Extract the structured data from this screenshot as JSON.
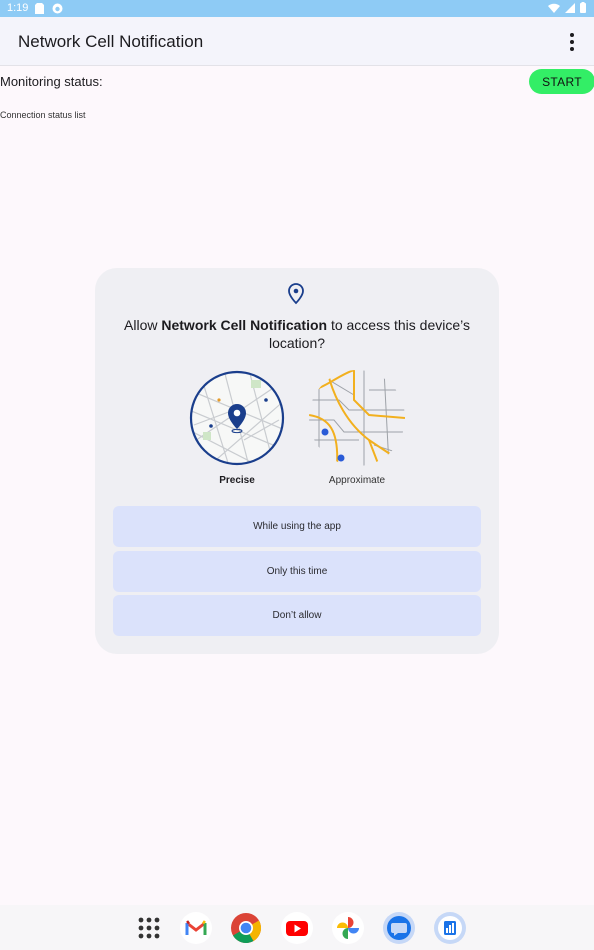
{
  "status_bar": {
    "time": "1:19"
  },
  "app_bar": {
    "title": "Network Cell Notification"
  },
  "main": {
    "monitoring_label": "Monitoring status:",
    "start_button": "START",
    "connection_list_label": "Connection status list"
  },
  "dialog": {
    "title_prefix": "Allow ",
    "app_name": "Network Cell Notification",
    "title_suffix": " to access this device’s location?",
    "precise_label": "Precise",
    "approximate_label": "Approximate",
    "buttons": {
      "while_using": "While using the app",
      "only_this_time": "Only this time",
      "dont_allow": "Don’t allow"
    },
    "selected_option": "Precise"
  },
  "dock": {
    "apps": [
      "app-drawer",
      "gmail",
      "chrome",
      "youtube",
      "photos",
      "messages",
      "network-cell-app"
    ]
  },
  "colors": {
    "status_bar": "#8ecbf5",
    "start_button": "#33ee66",
    "dialog_bg": "#efeff3",
    "dialog_button": "#dbe2fb",
    "accent_blue": "#1a3e8c"
  }
}
